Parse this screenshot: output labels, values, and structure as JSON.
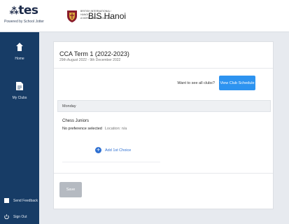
{
  "brand": {
    "logo_text": "tes",
    "tagline": "Powered by School Jotter"
  },
  "school": {
    "name": "BIS Hanoi",
    "sub_lines": [
      "BRITISH INTERNATIONAL SCHOOL",
      "HANOI",
      "A NORD ANGLIA EDUCATION SCHOOL"
    ]
  },
  "sidebar": {
    "home_label": "Home",
    "myclubs_label": "My Clubs",
    "feedback_label": "Send Feedback",
    "signout_label": "Sign Out"
  },
  "term": {
    "title": "CCA Term 1 (2022-2023)",
    "dates": "29th August 2022 - 9th December 2022"
  },
  "actions": {
    "want_text": "Want to see all clubs?",
    "schedule_label": "View Club Schedule"
  },
  "day": {
    "label": "Monday"
  },
  "club": {
    "name": "Chess Juniors",
    "status": "No preference selected",
    "location": "Location: n/a"
  },
  "add": {
    "label": "Add 1st Choice"
  },
  "save": {
    "label": "Save"
  },
  "colors": {
    "sidebar": "#173c66",
    "accent": "#2d93f0",
    "link": "#2d6fd1",
    "disabled": "#b5bac1"
  }
}
